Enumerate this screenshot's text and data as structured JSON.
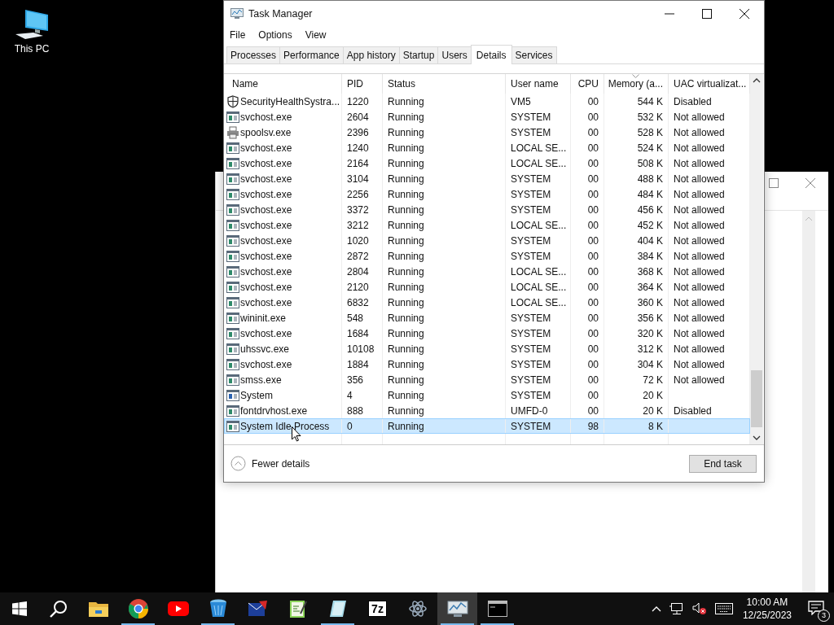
{
  "desktop": {
    "icons": [
      {
        "label": "This PC"
      }
    ]
  },
  "window": {
    "title": "Task Manager"
  },
  "menu": [
    "File",
    "Options",
    "View"
  ],
  "tabs": [
    {
      "label": "Processes",
      "selected": false
    },
    {
      "label": "Performance",
      "selected": false
    },
    {
      "label": "App history",
      "selected": false
    },
    {
      "label": "Startup",
      "selected": false
    },
    {
      "label": "Users",
      "selected": false
    },
    {
      "label": "Details",
      "selected": true
    },
    {
      "label": "Services",
      "selected": false
    }
  ],
  "table": {
    "columns": [
      {
        "label": "Name",
        "sorted": false
      },
      {
        "label": "PID",
        "sorted": false
      },
      {
        "label": "Status",
        "sorted": false
      },
      {
        "label": "User name",
        "sorted": false
      },
      {
        "label": "CPU",
        "sorted": false
      },
      {
        "label": "Memory (a...",
        "sorted": true
      },
      {
        "label": "UAC virtualizat...",
        "sorted": false
      }
    ],
    "rows": [
      {
        "kind": "shield",
        "name": "SecurityHealthSystra...",
        "pid": "1220",
        "status": "Running",
        "user": "VM5",
        "cpu": "00",
        "memory": "544 K",
        "uac": "Disabled",
        "selected": false
      },
      {
        "kind": "service",
        "name": "svchost.exe",
        "pid": "2604",
        "status": "Running",
        "user": "SYSTEM",
        "cpu": "00",
        "memory": "532 K",
        "uac": "Not allowed",
        "selected": false
      },
      {
        "kind": "printer",
        "name": "spoolsv.exe",
        "pid": "2396",
        "status": "Running",
        "user": "SYSTEM",
        "cpu": "00",
        "memory": "528 K",
        "uac": "Not allowed",
        "selected": false
      },
      {
        "kind": "service",
        "name": "svchost.exe",
        "pid": "1240",
        "status": "Running",
        "user": "LOCAL SE...",
        "cpu": "00",
        "memory": "524 K",
        "uac": "Not allowed",
        "selected": false
      },
      {
        "kind": "service",
        "name": "svchost.exe",
        "pid": "2164",
        "status": "Running",
        "user": "LOCAL SE...",
        "cpu": "00",
        "memory": "508 K",
        "uac": "Not allowed",
        "selected": false
      },
      {
        "kind": "service",
        "name": "svchost.exe",
        "pid": "3104",
        "status": "Running",
        "user": "SYSTEM",
        "cpu": "00",
        "memory": "488 K",
        "uac": "Not allowed",
        "selected": false
      },
      {
        "kind": "service",
        "name": "svchost.exe",
        "pid": "2256",
        "status": "Running",
        "user": "SYSTEM",
        "cpu": "00",
        "memory": "484 K",
        "uac": "Not allowed",
        "selected": false
      },
      {
        "kind": "service",
        "name": "svchost.exe",
        "pid": "3372",
        "status": "Running",
        "user": "SYSTEM",
        "cpu": "00",
        "memory": "456 K",
        "uac": "Not allowed",
        "selected": false
      },
      {
        "kind": "service",
        "name": "svchost.exe",
        "pid": "3212",
        "status": "Running",
        "user": "LOCAL SE...",
        "cpu": "00",
        "memory": "452 K",
        "uac": "Not allowed",
        "selected": false
      },
      {
        "kind": "service",
        "name": "svchost.exe",
        "pid": "1020",
        "status": "Running",
        "user": "SYSTEM",
        "cpu": "00",
        "memory": "404 K",
        "uac": "Not allowed",
        "selected": false
      },
      {
        "kind": "service",
        "name": "svchost.exe",
        "pid": "2872",
        "status": "Running",
        "user": "SYSTEM",
        "cpu": "00",
        "memory": "384 K",
        "uac": "Not allowed",
        "selected": false
      },
      {
        "kind": "service",
        "name": "svchost.exe",
        "pid": "2804",
        "status": "Running",
        "user": "LOCAL SE...",
        "cpu": "00",
        "memory": "368 K",
        "uac": "Not allowed",
        "selected": false
      },
      {
        "kind": "service",
        "name": "svchost.exe",
        "pid": "2120",
        "status": "Running",
        "user": "LOCAL SE...",
        "cpu": "00",
        "memory": "364 K",
        "uac": "Not allowed",
        "selected": false
      },
      {
        "kind": "service",
        "name": "svchost.exe",
        "pid": "6832",
        "status": "Running",
        "user": "LOCAL SE...",
        "cpu": "00",
        "memory": "360 K",
        "uac": "Not allowed",
        "selected": false
      },
      {
        "kind": "service",
        "name": "wininit.exe",
        "pid": "548",
        "status": "Running",
        "user": "SYSTEM",
        "cpu": "00",
        "memory": "356 K",
        "uac": "Not allowed",
        "selected": false
      },
      {
        "kind": "service",
        "name": "svchost.exe",
        "pid": "1684",
        "status": "Running",
        "user": "SYSTEM",
        "cpu": "00",
        "memory": "320 K",
        "uac": "Not allowed",
        "selected": false
      },
      {
        "kind": "service",
        "name": "uhssvc.exe",
        "pid": "10108",
        "status": "Running",
        "user": "SYSTEM",
        "cpu": "00",
        "memory": "312 K",
        "uac": "Not allowed",
        "selected": false
      },
      {
        "kind": "service",
        "name": "svchost.exe",
        "pid": "1884",
        "status": "Running",
        "user": "SYSTEM",
        "cpu": "00",
        "memory": "304 K",
        "uac": "Not allowed",
        "selected": false
      },
      {
        "kind": "service",
        "name": "smss.exe",
        "pid": "356",
        "status": "Running",
        "user": "SYSTEM",
        "cpu": "00",
        "memory": "72 K",
        "uac": "Not allowed",
        "selected": false
      },
      {
        "kind": "system",
        "name": "System",
        "pid": "4",
        "status": "Running",
        "user": "SYSTEM",
        "cpu": "00",
        "memory": "20 K",
        "selected": false
      },
      {
        "kind": "service",
        "name": "fontdrvhost.exe",
        "pid": "888",
        "status": "Running",
        "user": "UMFD-0",
        "cpu": "00",
        "memory": "20 K",
        "uac": "Disabled",
        "selected": false
      },
      {
        "kind": "service",
        "name": "System Idle Process",
        "pid": "0",
        "status": "Running",
        "user": "SYSTEM",
        "cpu": "98",
        "memory": "8 K",
        "selected": true
      }
    ]
  },
  "footer": {
    "fewer_details": "Fewer details",
    "end_task": "End task"
  },
  "taskbar": {
    "apps": [
      {
        "kind": "explorer",
        "running": false,
        "active": false
      },
      {
        "kind": "chrome",
        "running": true,
        "active": false
      },
      {
        "kind": "youtube",
        "running": false,
        "active": false
      },
      {
        "kind": "bucket",
        "running": true,
        "active": false
      },
      {
        "kind": "mail",
        "running": false,
        "active": false
      },
      {
        "kind": "notepad",
        "running": false,
        "active": false
      },
      {
        "kind": "paper",
        "running": true,
        "active": false
      },
      {
        "kind": "archiver",
        "label": "7z",
        "running": false,
        "active": false
      },
      {
        "kind": "atom",
        "running": false,
        "active": false
      },
      {
        "kind": "taskmgr",
        "running": true,
        "active": true
      },
      {
        "kind": "terminal",
        "running": true,
        "active": false
      }
    ],
    "time": "10:00 AM",
    "date": "12/25/2023",
    "notifications": "3"
  }
}
